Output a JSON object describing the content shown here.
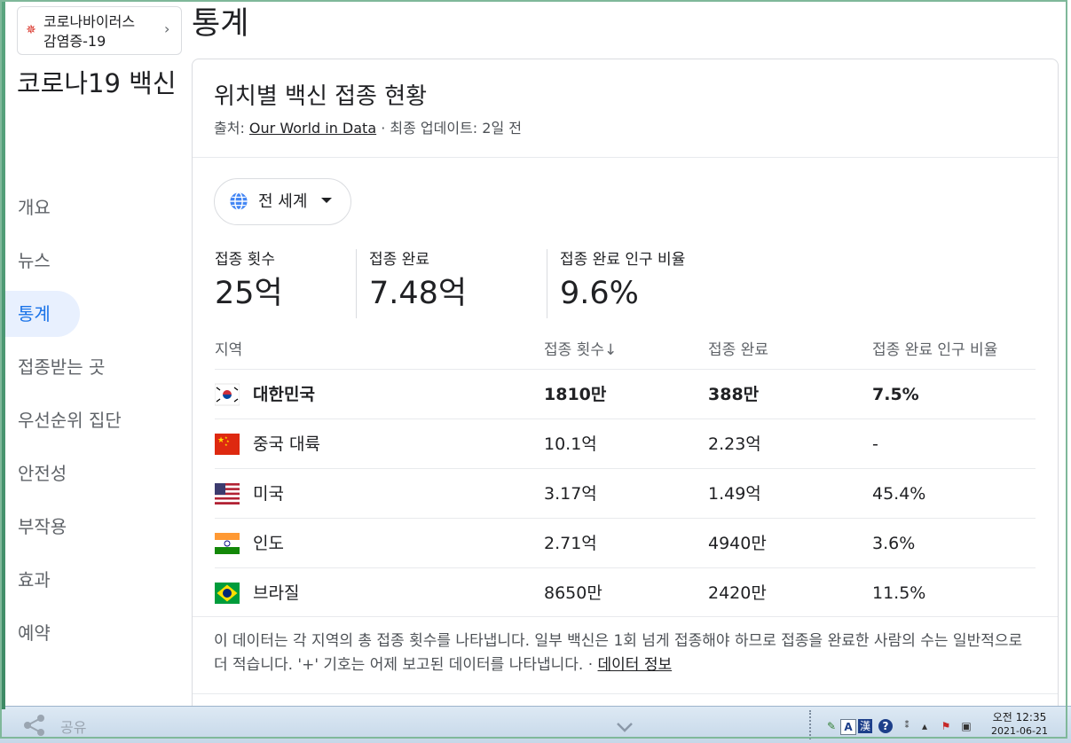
{
  "topic": {
    "line1": "코로나바이러스",
    "line2": "감염증-19",
    "icon": "virus-icon"
  },
  "page_title": "통계",
  "sidebar": {
    "title": "코로나19 백신",
    "items": [
      {
        "label": "개요",
        "active": false
      },
      {
        "label": "뉴스",
        "active": false
      },
      {
        "label": "통계",
        "active": true
      },
      {
        "label": "접종받는 곳",
        "active": false
      },
      {
        "label": "우선순위 집단",
        "active": false
      },
      {
        "label": "안전성",
        "active": false
      },
      {
        "label": "부작용",
        "active": false
      },
      {
        "label": "효과",
        "active": false
      },
      {
        "label": "예약",
        "active": false
      }
    ]
  },
  "card": {
    "title": "위치별 백신 접종 현황",
    "source_prefix": "출처: ",
    "source_link": "Our World in Data",
    "source_suffix": " · 최종 업데이트: 2일 전",
    "region_select": "전 세계",
    "stats": [
      {
        "label": "접종 횟수",
        "value": "25억"
      },
      {
        "label": "접종 완료",
        "value": "7.48억"
      },
      {
        "label": "접종 완료 인구 비율",
        "value": "9.6%"
      }
    ],
    "table": {
      "headers": [
        "지역",
        "접종 횟수↓",
        "접종 완료",
        "접종 완료 인구 비율"
      ],
      "rows": [
        {
          "region": "대한민국",
          "doses": "1810만",
          "complete": "388만",
          "ratio": "7.5%",
          "flag": "south-korea-flag-icon",
          "bold": true
        },
        {
          "region": "중국 대륙",
          "doses": "10.1억",
          "complete": "2.23억",
          "ratio": "-",
          "flag": "china-flag-icon",
          "bold": false
        },
        {
          "region": "미국",
          "doses": "3.17억",
          "complete": "1.49억",
          "ratio": "45.4%",
          "flag": "usa-flag-icon",
          "bold": false
        },
        {
          "region": "인도",
          "doses": "2.71억",
          "complete": "4940만",
          "ratio": "3.6%",
          "flag": "india-flag-icon",
          "bold": false
        },
        {
          "region": "브라질",
          "doses": "8650만",
          "complete": "2420만",
          "ratio": "11.5%",
          "flag": "brazil-flag-icon",
          "bold": false
        }
      ]
    },
    "footnote": "이 데이터는 각 지역의 총 접종 횟수를 나타냅니다. 일부 백신은 1회 넘게 접종해야 하므로 접종을 완료한 사람의 수는 일반적으로 더 적습니다. '+' 기호는 어제 보고된 데이터를 나타냅니다. · ",
    "footnote_link": "데이터 정보"
  },
  "taskbar": {
    "share_label": "공유",
    "time": "오전 12:35",
    "date": "2021-06-21",
    "ime_a": "A",
    "ime_han": "漢"
  },
  "colors": {
    "accent": "#1a73e8",
    "active_bg": "#e8f0fe",
    "text": "#202124",
    "muted": "#5f6368"
  }
}
